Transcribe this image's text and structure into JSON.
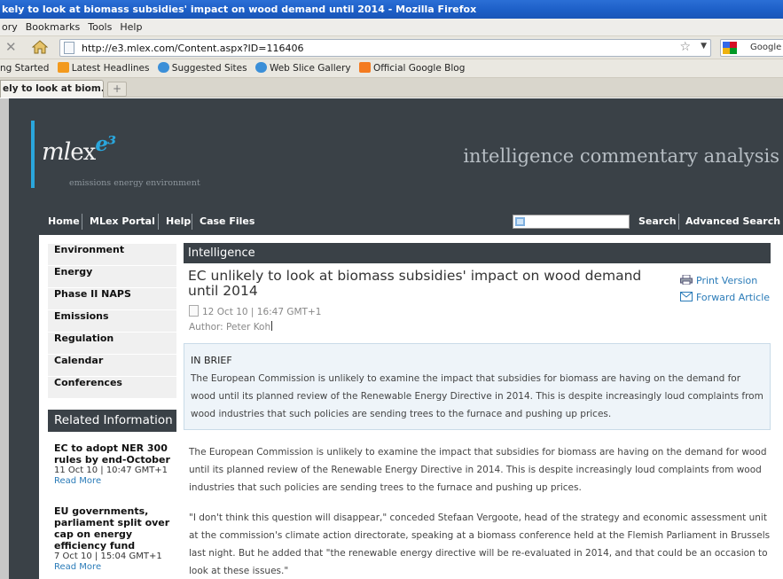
{
  "browser": {
    "title": "kely to look at biomass subsidies' impact on wood demand until 2014 - Mozilla Firefox",
    "menu": [
      "ory",
      "Bookmarks",
      "Tools",
      "Help"
    ],
    "url": "http://e3.mlex.com/Content.aspx?ID=116406",
    "search_engine": "Google t",
    "bookmarks": [
      "ng Started",
      "Latest Headlines",
      "Suggested Sites",
      "Web Slice Gallery",
      "Official Google Blog"
    ],
    "tab_label": "ely to look at biom...",
    "new_tab": "+"
  },
  "site": {
    "logo_text": "ml",
    "logo_lex": "ex",
    "logo_e3": "e³",
    "logo_sub": "emissions energy environment",
    "tagline": "intelligence commentary analysis",
    "nav": [
      "Home",
      "MLex Portal",
      "Help",
      "Case Files"
    ],
    "search_button": "Search",
    "advanced_search": "Advanced Search"
  },
  "leftnav": [
    "Environment",
    "Energy",
    "Phase II NAPS",
    "Emissions",
    "Regulation",
    "Calendar",
    "Conferences"
  ],
  "related": {
    "heading": "Related Information",
    "items": [
      {
        "title": "EC to adopt NER 300 rules by end-October",
        "date": "11 Oct 10 | 10:47 GMT+1",
        "more": "Read More"
      },
      {
        "title": "EU governments, parliament split over cap on energy efficiency fund",
        "date": "7 Oct 10 | 15:04 GMT+1",
        "more": "Read More"
      }
    ]
  },
  "article": {
    "section": "Intelligence",
    "headline": "EC unlikely to look at biomass subsidies' impact on wood demand until 2014",
    "date": "12 Oct 10 | 16:47 GMT+1",
    "author": "Author: Peter Koh",
    "print": "Print Version",
    "forward": "Forward Article",
    "brief_label": "IN BRIEF",
    "brief_text": "The European Commission is unlikely to examine the impact that subsidies for biomass are having on the demand for wood until its planned review of the Renewable Energy Directive in 2014. This is despite increasingly loud complaints from wood industries that such policies are sending trees to the furnace and pushing up prices.",
    "paragraphs": [
      "The European Commission is unlikely to examine the impact that subsidies for biomass are having on the demand for wood until its planned review of the Renewable Energy Directive in 2014. This is despite increasingly loud complaints from wood industries that such policies are sending trees to the furnace and pushing up prices.",
      "\"I don't think this question will disappear,\" conceded Stefaan Vergoote, head of the strategy and economic assessment unit at the commission's climate action directorate, speaking at a biomass conference held at the Flemish Parliament in Brussels last night. But he added that \"the renewable energy directive will be re-evaluated in 2014, and that could be an occasion to look at these issues.\""
    ]
  },
  "colors": {
    "dark": "#3a4147",
    "accent": "#2aa6dc",
    "link": "#2a7bb8",
    "brief_bg": "#eef4f9"
  }
}
